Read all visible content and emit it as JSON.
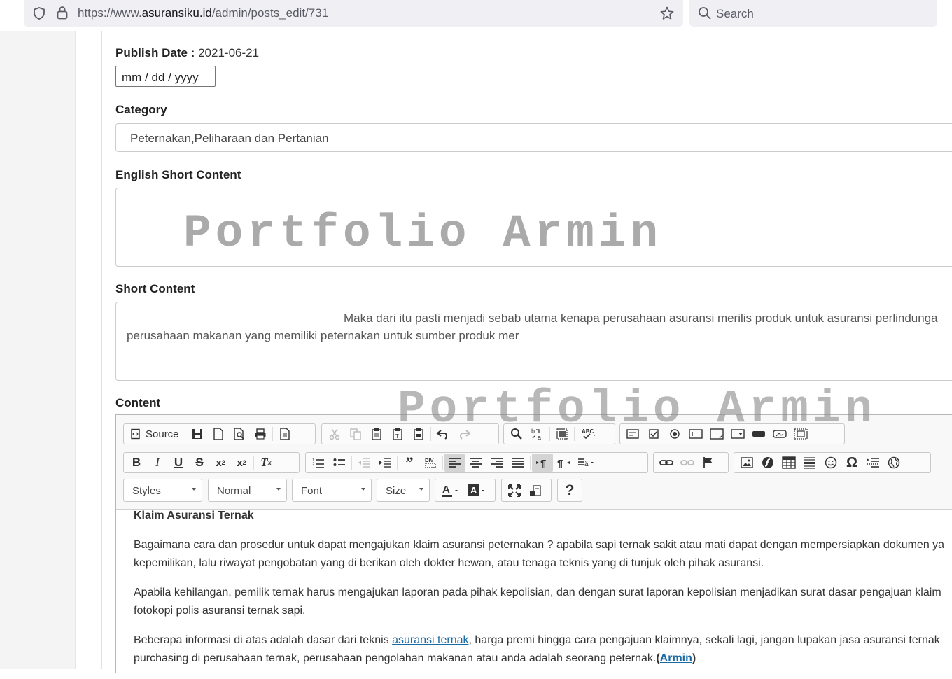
{
  "browser": {
    "url_prefix": "https://www.",
    "url_domain": "asuransiku.id",
    "url_path": "/admin/posts_edit/731",
    "search_placeholder": "Search"
  },
  "form": {
    "publish_date_label": "Publish Date :",
    "publish_date_value": "2021-06-21",
    "date_input_placeholder": "mm / dd / yyyy",
    "category_label": "Category",
    "category_value": "Peternakan,Peliharaan dan Pertanian",
    "english_short_label": "English Short Content",
    "short_content_label": "Short Content",
    "short_content_line1": "Maka dari itu pasti menjadi sebab utama kenapa perusahaan asuransi merilis produk untuk asuransi perlindunga",
    "short_content_line2": "perusahaan makanan yang memiliki peternakan untuk sumber produk mer",
    "content_label": "Content"
  },
  "watermark": "Portfolio Armin",
  "editor": {
    "source_label": "Source",
    "styles_label": "Styles",
    "format_label": "Normal",
    "font_label": "Font",
    "size_label": "Size",
    "help_label": "?",
    "heading": "Klaim Asuransi Ternak",
    "p1_line1": "Bagaimana cara dan prosedur untuk dapat mengajukan klaim asuransi peternakan ? apabila sapi ternak sakit atau mati dapat dengan mempersiapkan dokumen ya",
    "p1_line2": "kepemilikan, lalu riwayat pengobatan yang di berikan oleh dokter hewan, atau tenaga teknis yang di tunjuk oleh pihak asuransi.",
    "p2_line1": "Apabila kehilangan, pemilik ternak harus mengajukan laporan pada pihak kepolisian, dan dengan surat laporan kepolisian menjadikan surat dasar pengajuan klaim",
    "p2_line2": "fotokopi polis asuransi ternak sapi.",
    "p3_line1_before": "Beberapa informasi di atas adalah dasar dari teknis ",
    "p3_link": "asuransi ternak",
    "p3_line1_after": ", harga premi hingga cara pengajuan klaimnya, sekali lagi, jangan lupakan jasa asuransi ternak",
    "p3_line2_before": "purchasing di perusahaan ternak, perusahaan pengolahan makanan atau anda adalah seorang peternak.",
    "p3_open": "(",
    "p3_author": "Armin",
    "p3_close": ")"
  }
}
